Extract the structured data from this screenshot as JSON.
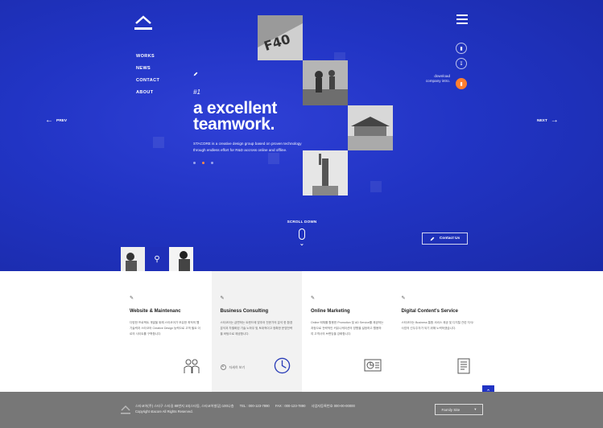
{
  "nav": {
    "items": [
      "WORKS",
      "NEWS",
      "CONTACT",
      "ABOUT"
    ]
  },
  "hero": {
    "number": "#1",
    "headline_1": "a excellent",
    "headline_2": "teamwork.",
    "description": "STACORE is a creative design group based on proven technology through endless effort for R&D accross online and offline."
  },
  "slider": {
    "prev_label": "PREV",
    "next_label": "NEXT"
  },
  "download": {
    "label": "download company intro."
  },
  "scroll": {
    "label": "SCROLL DOWN"
  },
  "contact_button": {
    "label": "Contact Us"
  },
  "services": [
    {
      "title": "Website & Maintenanc",
      "text": "다양한 프로젝트 개발을 위해 스타코어가 보유한 최적의 웹 기술력과 스타코어 Creative Design 능력으로 고객 필요 이르의 사이트를 구축합니다.",
      "icon": "people-icon"
    },
    {
      "title": "Business Consulting",
      "text": "스타코어는 급변하는 트렌드에 맞추어 전문가의 분석 한 환경분석과 차별화된 기술 노하우 및 토대적이고 정확한 운영전략을 바탕으로 제공합니다.",
      "more": "자세히 보기",
      "icon": "clock-icon"
    },
    {
      "title": "Online Marketing",
      "text": "Online 매체를 활용한 Promotion 및 AD Service를 제공하는 과정으로 전략적인 커뮤니케이션의 방향을 설정하고 활용하여 고객사의 브랜딩을 강화합니다.",
      "icon": "chart-icon"
    },
    {
      "title": "Digital Content's Service",
      "text": "스타코어는 Business 통합 서비스 제공 및 디지털 관련 지식/사업의 선두주자가 되기 위해 노력하겠습니다.",
      "icon": "document-icon"
    }
  ],
  "footer": {
    "address": "스타코어(주) 스타구 스타길 88번지 10(스타동, 스타코어빌딩) 100나층",
    "tel": "TEL : 000-123-7890",
    "fax": "FAX : 000-123-7890",
    "biz": "사업자등록번호 000-00-00000",
    "copyright": "Copyright stacore All Rights Reserved.",
    "family_site": "Family Site"
  },
  "colors": {
    "hero_blue": "#2134c4",
    "accent_orange": "#ff7f2f",
    "footer_gray": "#777777"
  }
}
